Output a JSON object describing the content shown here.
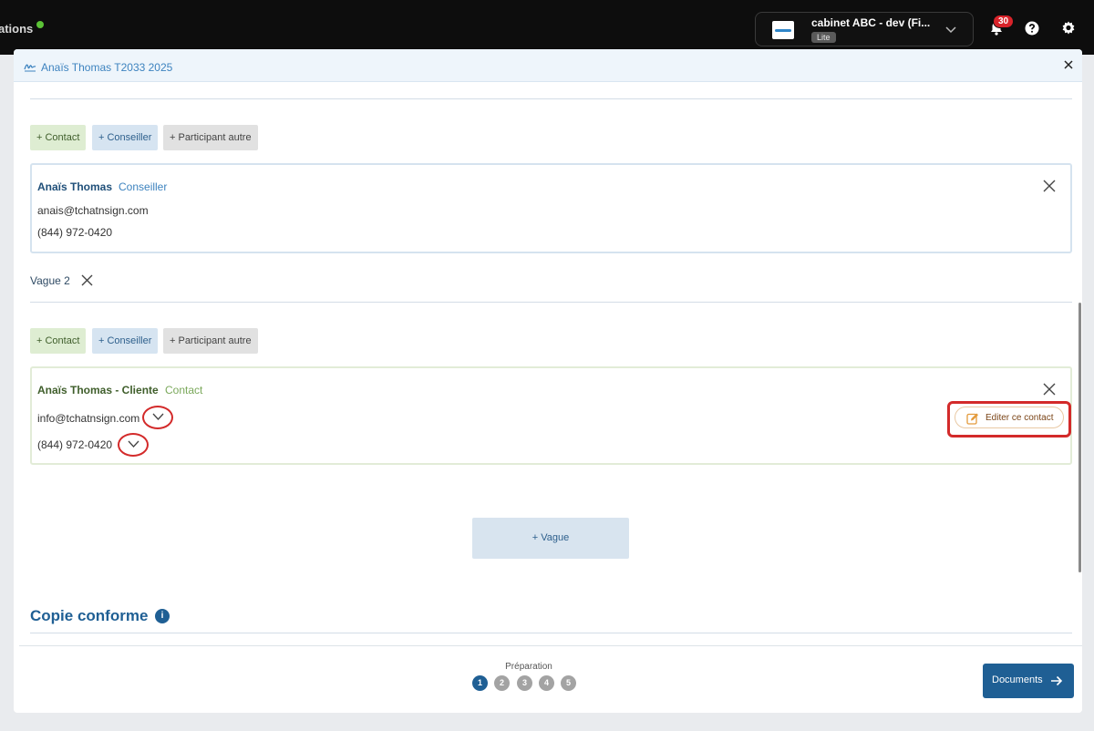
{
  "app": {
    "brand_fragment": "ations"
  },
  "org": {
    "name": "cabinet ABC - dev (Fi...",
    "plan": "Lite"
  },
  "notifications": {
    "count": "30"
  },
  "modal": {
    "title": "Anaïs Thomas T2033 2025"
  },
  "participant_buttons": {
    "contact": "+ Contact",
    "conseiller": "+ Conseiller",
    "autre": "+ Participant autre"
  },
  "wave1": {
    "card": {
      "name": "Anaïs Thomas",
      "role": "Conseiller",
      "email": "anais@tchatnsign.com",
      "phone": "(844) 972-0420"
    }
  },
  "wave2": {
    "label": "Vague 2",
    "card": {
      "name": "Anaïs Thomas - Cliente",
      "role": "Contact",
      "email": "info@tchatnsign.com",
      "phone": "(844) 972-0420",
      "edit_label": "Editer ce contact"
    }
  },
  "add_wave_label": "+ Vague",
  "copie": {
    "title": "Copie conforme",
    "info": "i"
  },
  "footer": {
    "step_label": "Préparation",
    "steps": [
      "1",
      "2",
      "3",
      "4",
      "5"
    ],
    "active_step": 1,
    "next_label": "Documents"
  },
  "colors": {
    "accent": "#1f5f94",
    "link": "#3d83bf",
    "highlight": "#d32a2a",
    "contact_green": "#3f5e2b"
  }
}
